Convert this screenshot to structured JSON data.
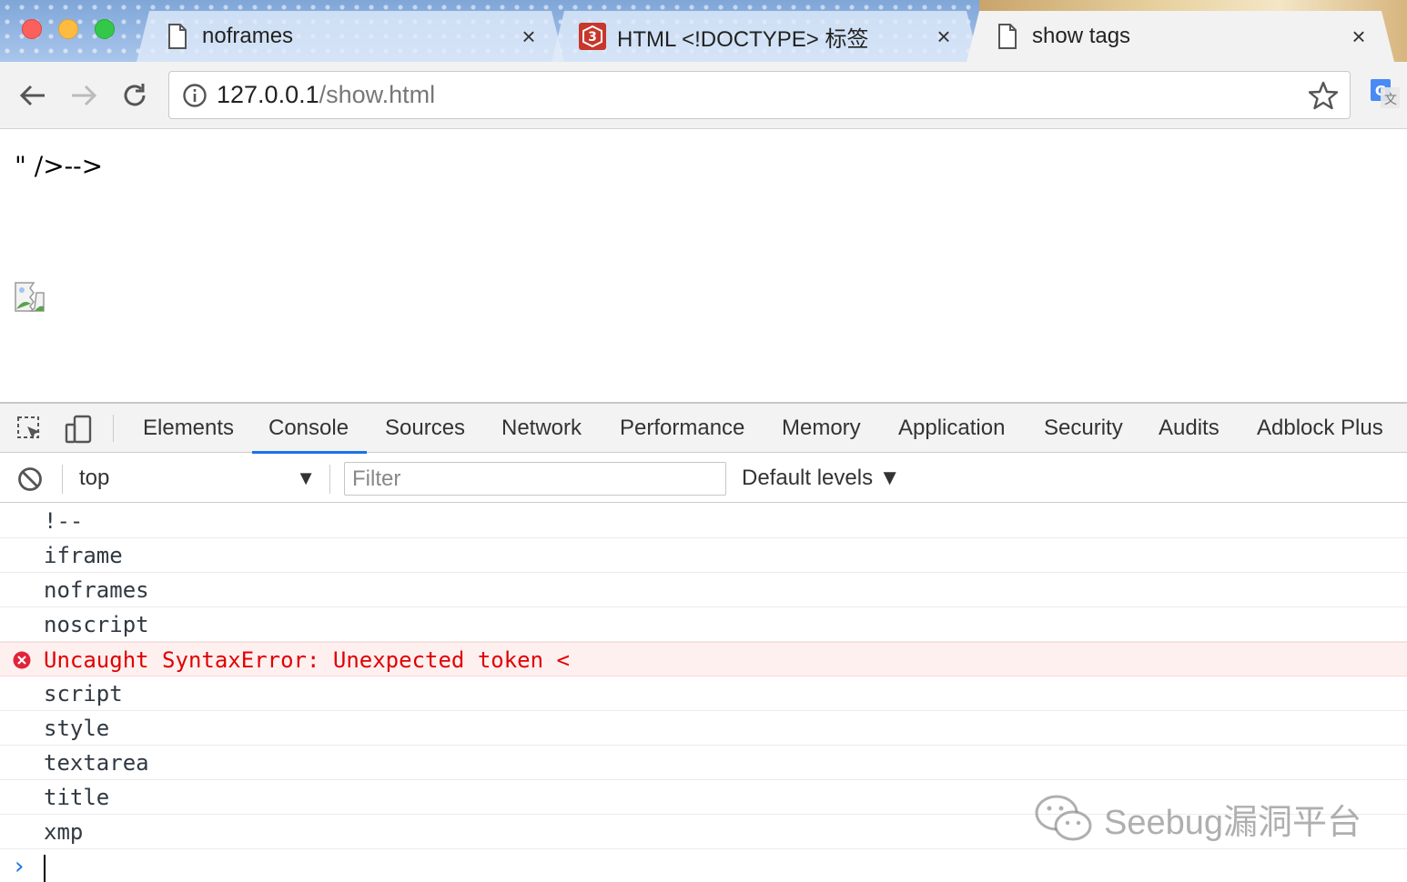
{
  "tabs": [
    {
      "title": "noframes",
      "favicon": "page-icon",
      "active": false
    },
    {
      "title": "HTML <!DOCTYPE> 标签",
      "favicon": "w3school-icon",
      "active": false
    },
    {
      "title": "show tags",
      "favicon": "page-icon",
      "active": true
    }
  ],
  "omnibox": {
    "host": "127.0.0.1",
    "path": "/show.html"
  },
  "page": {
    "text": "\" />-->"
  },
  "devtools": {
    "tabs": [
      "Elements",
      "Console",
      "Sources",
      "Network",
      "Performance",
      "Memory",
      "Application",
      "Security",
      "Audits",
      "Adblock Plus"
    ],
    "active_tab": "Console",
    "context": "top",
    "filter_placeholder": "Filter",
    "levels_label": "Default levels ▼",
    "messages": [
      {
        "text": "!--",
        "level": "log"
      },
      {
        "text": "iframe",
        "level": "log"
      },
      {
        "text": "noframes",
        "level": "log"
      },
      {
        "text": "noscript",
        "level": "log"
      },
      {
        "text": "Uncaught SyntaxError: Unexpected token <",
        "level": "error"
      },
      {
        "text": "script",
        "level": "log"
      },
      {
        "text": "style",
        "level": "log"
      },
      {
        "text": "textarea",
        "level": "log"
      },
      {
        "text": "title",
        "level": "log"
      },
      {
        "text": "xmp",
        "level": "log"
      }
    ]
  },
  "watermark": "Seebug漏洞平台",
  "colors": {
    "accent": "#1a73e8",
    "error": "#e00000",
    "error_bg": "#fff0f0"
  }
}
